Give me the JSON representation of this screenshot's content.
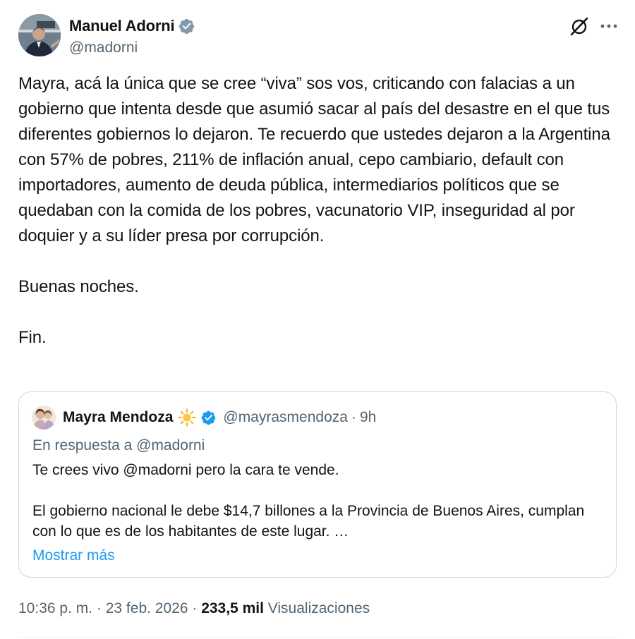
{
  "author": {
    "name": "Manuel Adorni",
    "handle": "@madorni"
  },
  "tweet": {
    "text": "Mayra, acá la única que se cree “viva” sos vos, criticando con falacias a un gobierno que intenta desde que asumió sacar al país del desastre en el que tus diferentes gobiernos lo dejaron. Te recuerdo que ustedes dejaron a la Argentina con 57% de pobres, 211% de inflación anual, cepo cambiario, default con importadores, aumento de deuda pública, intermediarios políticos que se quedaban con la comida de los pobres, vacunatorio VIP, inseguridad al por doquier y a su líder presa por corrupción.\n\nBuenas noches.\n\nFin."
  },
  "quote": {
    "name": "Mayra Mendoza",
    "handle": "@mayrasmendoza",
    "separator": "·",
    "time": "9h",
    "reply_to": "En respuesta a @madorni",
    "text": "Te crees vivo @madorni pero la cara te vende.\n\nEl gobierno nacional le debe $14,7 billones a la Provincia de Buenos Aires, cumplan con lo que es de los habitantes de este lugar. …",
    "show_more": "Mostrar más"
  },
  "meta": {
    "time": "10:36 p. m.",
    "sep1": " · ",
    "date": "23 feb. 2026",
    "sep2": " · ",
    "views_count": "233,5 mil",
    "views_label": " Visualizaciones"
  },
  "icons": {
    "verified": "verified-badge-icon",
    "grok": "grok-icon",
    "more": "more-options-icon",
    "sun": "sun-emoji-icon"
  },
  "colors": {
    "text_primary": "#0f1419",
    "text_secondary": "#536471",
    "accent": "#1d9bf0",
    "border": "#cfd9de",
    "verified": "#1d9bf0"
  }
}
